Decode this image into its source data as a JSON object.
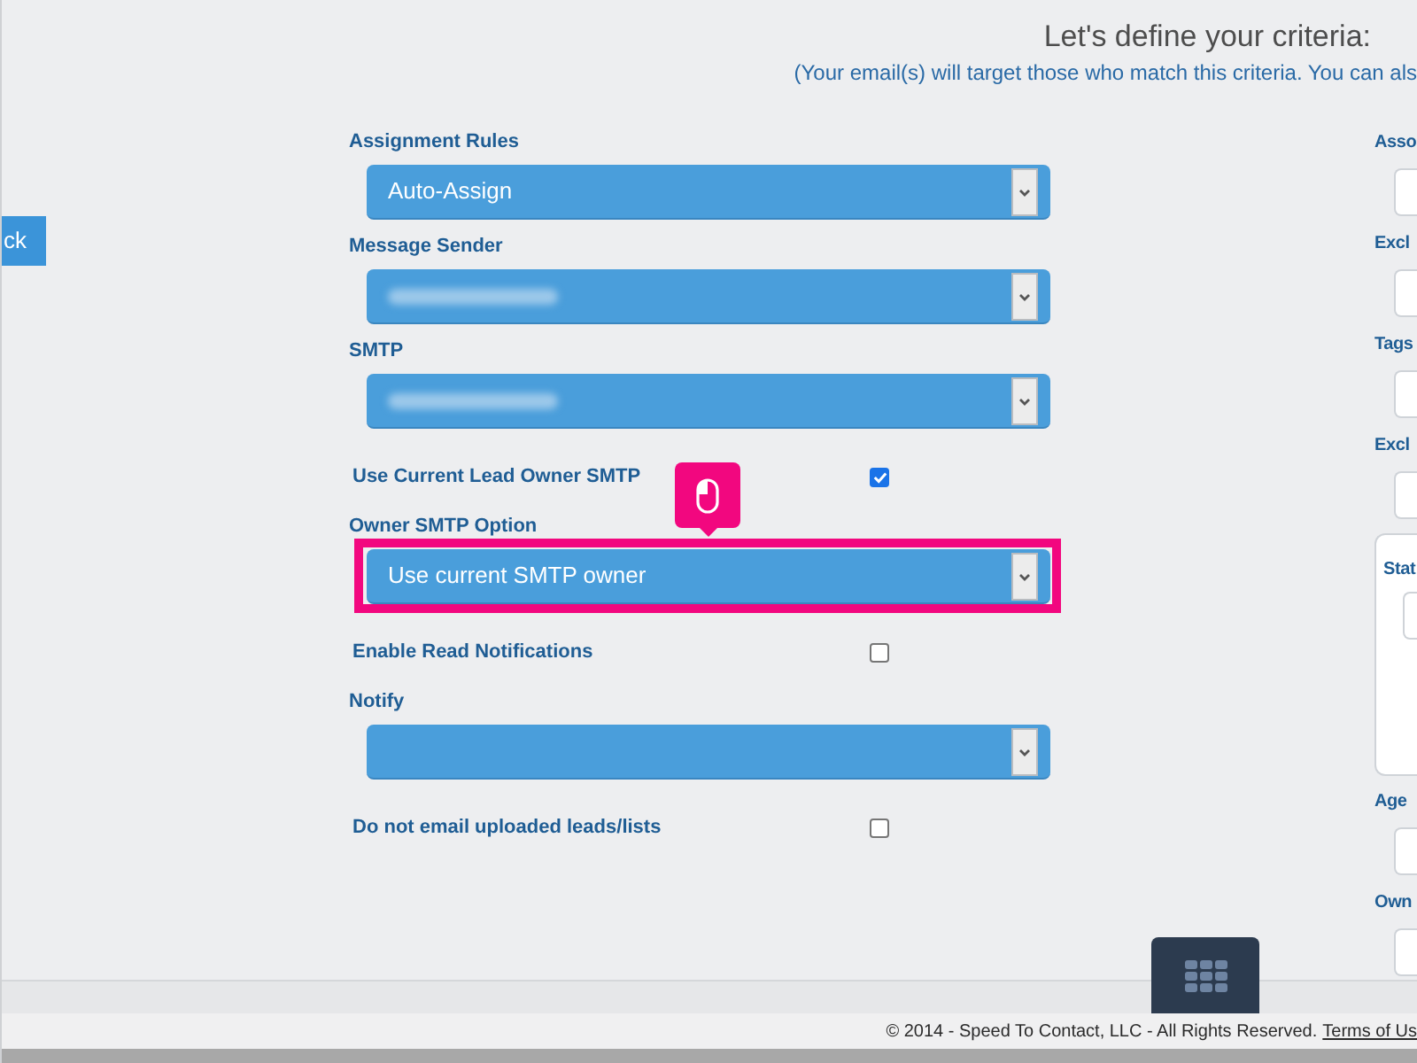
{
  "header": {
    "title": "Let's define your criteria:",
    "subtitle": "(Your email(s) will target those who match this criteria. You can als"
  },
  "back_button": {
    "label": "ck"
  },
  "form": {
    "fields": [
      {
        "kind": "select",
        "label": "Assignment Rules",
        "value": "Auto-Assign",
        "redacted": false,
        "highlighted": false
      },
      {
        "kind": "select",
        "label": "Message Sender",
        "redacted": true,
        "highlighted": false
      },
      {
        "kind": "select",
        "label": "SMTP",
        "redacted": true,
        "highlighted": false
      },
      {
        "kind": "checkbox",
        "label": "Use Current Lead Owner SMTP",
        "checked": true
      },
      {
        "kind": "select",
        "label": "Owner SMTP Option",
        "value": "Use current SMTP owner",
        "redacted": false,
        "highlighted": true
      },
      {
        "kind": "checkbox",
        "label": "Enable Read Notifications",
        "checked": false
      },
      {
        "kind": "select",
        "label": "Notify",
        "redacted": false,
        "highlighted": false
      },
      {
        "kind": "checkbox",
        "label": "Do not email uploaded leads/lists",
        "checked": false
      }
    ]
  },
  "right_column": {
    "fields": [
      {
        "kind": "input",
        "label": "Asso"
      },
      {
        "kind": "input",
        "label": "Excl"
      },
      {
        "kind": "input",
        "label": "Tags"
      },
      {
        "kind": "input",
        "label": "Excl"
      },
      {
        "kind": "panel",
        "label": "Stat"
      },
      {
        "kind": "input",
        "label": "Age"
      },
      {
        "kind": "input",
        "label": "Own"
      }
    ]
  },
  "footer": {
    "copyright": "© 2014 - Speed To Contact, LLC - All Rights Reserved.",
    "link": "Terms of Us"
  }
}
